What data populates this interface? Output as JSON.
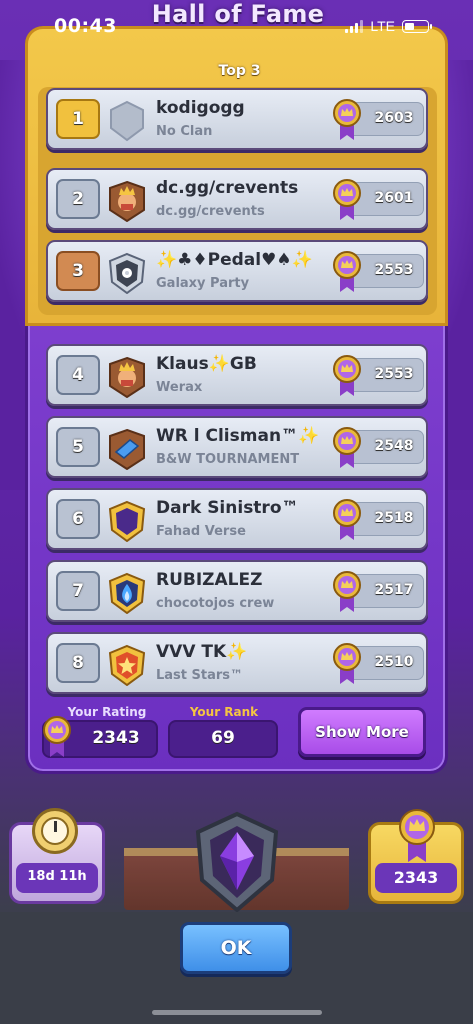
{
  "status_bar": {
    "time": "00:43",
    "network": "LTE"
  },
  "title": "Hall of Fame",
  "top3_label": "Top 3",
  "players": [
    {
      "rank": "1",
      "name": "kodigogg",
      "clan": "No Clan",
      "rating": "2603",
      "badge": "no-clan-badge",
      "rank_style": "gold"
    },
    {
      "rank": "2",
      "name": "dc.gg/crevents",
      "clan": "dc.gg/crevents",
      "rating": "2601",
      "badge": "king-badge",
      "rank_style": "silver"
    },
    {
      "rank": "3",
      "name": "✨♣♦Pedal♥♠✨",
      "clan": "Galaxy Party",
      "rating": "2553",
      "badge": "flower-shield-badge",
      "rank_style": "bronze"
    },
    {
      "rank": "4",
      "name": "Klaus✨GB",
      "clan": "Werax",
      "rating": "2553",
      "badge": "king-badge",
      "rank_style": "silver"
    },
    {
      "rank": "5",
      "name": "WR l Clisman™✨",
      "clan": "B&W TOURNAMENT",
      "rating": "2548",
      "badge": "blue-crystal-badge",
      "rank_style": "silver"
    },
    {
      "rank": "6",
      "name": "Dark Sinistro™",
      "clan": "Fahad Verse",
      "rating": "2518",
      "badge": "moon-badge",
      "rank_style": "silver"
    },
    {
      "rank": "7",
      "name": "RUBIZALEZ",
      "clan": "chocotojos crew",
      "rating": "2517",
      "badge": "blue-flame-badge",
      "rank_style": "silver"
    },
    {
      "rank": "8",
      "name": "VVV TK✨",
      "clan": "Last Stars™",
      "rating": "2510",
      "badge": "star-badge",
      "rank_style": "silver"
    }
  ],
  "your_rating": {
    "label": "Your Rating",
    "value": "2343"
  },
  "your_rank": {
    "label": "Your Rank",
    "value": "69"
  },
  "show_more_label": "Show More",
  "season_timer": "18d 11h",
  "current_rating": "2343",
  "ok_label": "OK",
  "colors": {
    "gold": "#f1c13e",
    "purple": "#6b2fc0",
    "ok_blue": "#3f8fe8",
    "your_rank_gold": "#f5c542"
  }
}
